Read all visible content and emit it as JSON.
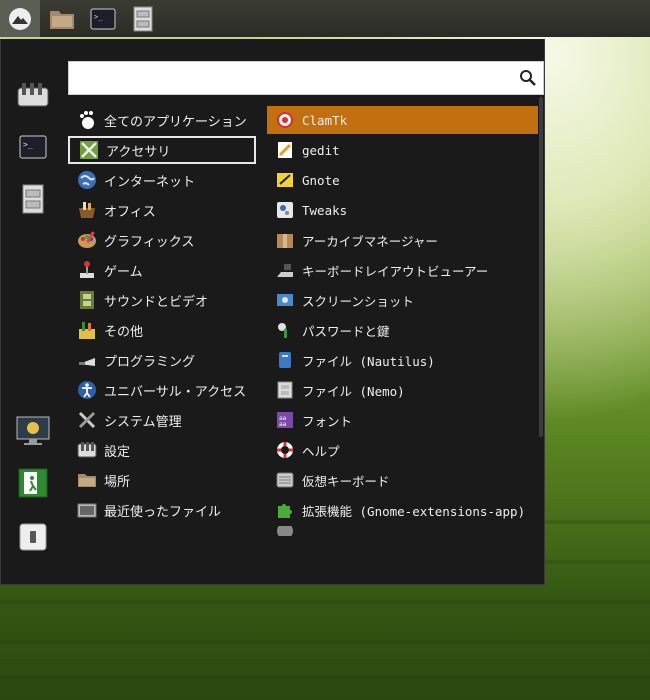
{
  "search": {
    "value": "",
    "placeholder": ""
  },
  "categories": [
    {
      "label": "全てのアプリケーション",
      "icon": "gnome-foot-icon"
    },
    {
      "label": "アクセサリ",
      "icon": "accessories-icon"
    },
    {
      "label": "インターネット",
      "icon": "globe-icon"
    },
    {
      "label": "オフィス",
      "icon": "office-icon"
    },
    {
      "label": "グラフィックス",
      "icon": "palette-icon"
    },
    {
      "label": "ゲーム",
      "icon": "joystick-icon"
    },
    {
      "label": "サウンドとビデオ",
      "icon": "film-icon"
    },
    {
      "label": "その他",
      "icon": "misc-icon"
    },
    {
      "label": "プログラミング",
      "icon": "trowel-icon"
    },
    {
      "label": "ユニバーサル・アクセス",
      "icon": "accessibility-icon"
    },
    {
      "label": "システム管理",
      "icon": "tools-icon"
    },
    {
      "label": "設定",
      "icon": "settings-icon"
    },
    {
      "label": "場所",
      "icon": "folder-icon"
    },
    {
      "label": "最近使ったファイル",
      "icon": "recent-icon"
    }
  ],
  "apps": [
    {
      "label": "ClamTk",
      "icon": "clamtk-icon"
    },
    {
      "label": "gedit",
      "icon": "gedit-icon"
    },
    {
      "label": "Gnote",
      "icon": "gnote-icon"
    },
    {
      "label": "Tweaks",
      "icon": "tweaks-icon"
    },
    {
      "label": "アーカイブマネージャー",
      "icon": "archive-icon"
    },
    {
      "label": "キーボードレイアウトビューアー",
      "icon": "keyboard-layout-icon"
    },
    {
      "label": "スクリーンショット",
      "icon": "screenshot-icon"
    },
    {
      "label": "パスワードと鍵",
      "icon": "key-icon"
    },
    {
      "label": "ファイル (Nautilus)",
      "icon": "nautilus-icon"
    },
    {
      "label": "ファイル (Nemo)",
      "icon": "nemo-icon"
    },
    {
      "label": "フォント",
      "icon": "font-icon"
    },
    {
      "label": "ヘルプ",
      "icon": "lifebuoy-icon"
    },
    {
      "label": "仮想キーボード",
      "icon": "virtual-keyboard-icon"
    },
    {
      "label": "拡張機能 (Gnome-extensions-app)",
      "icon": "puzzle-icon"
    }
  ],
  "colors": {
    "highlight": "#c2700f",
    "menu_bg": "#1a1a1a"
  }
}
